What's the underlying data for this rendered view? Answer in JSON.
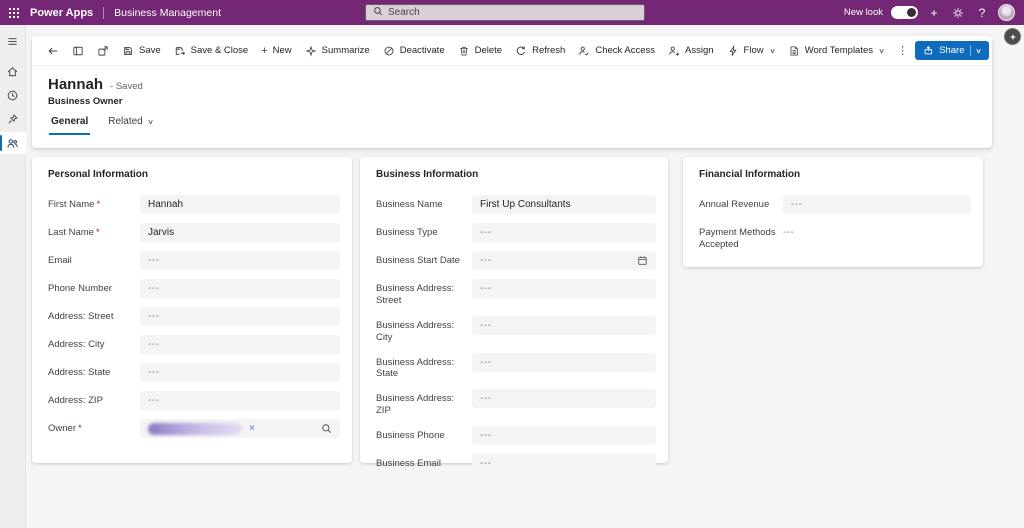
{
  "topbar": {
    "app": "Power Apps",
    "section": "Business Management",
    "search_placeholder": "Search",
    "new_look": "New look"
  },
  "commandbar": {
    "save": "Save",
    "save_close": "Save & Close",
    "new": "New",
    "summarize": "Summarize",
    "deactivate": "Deactivate",
    "delete": "Delete",
    "refresh": "Refresh",
    "check_access": "Check Access",
    "assign": "Assign",
    "flow": "Flow",
    "word_templates": "Word Templates",
    "share": "Share"
  },
  "record": {
    "title": "Hannah",
    "status": "- Saved",
    "entity": "Business Owner",
    "tabs": [
      {
        "label": "General"
      },
      {
        "label": "Related"
      }
    ]
  },
  "ui": {
    "required_marker": "*",
    "dismiss_glyph": "×"
  },
  "icons": {
    "plus": "+",
    "question": "?",
    "more": "⋮",
    "chevron": "∨"
  },
  "cards": [
    {
      "title": "Personal Information",
      "fields": [
        {
          "label": "First Name",
          "required": true,
          "value": "Hannah",
          "type": "text"
        },
        {
          "label": "Last Name",
          "required": true,
          "value": "Jarvis",
          "type": "text"
        },
        {
          "label": "Email",
          "value": "---",
          "empty": true,
          "type": "text"
        },
        {
          "label": "Phone Number",
          "value": "---",
          "empty": true,
          "type": "text"
        },
        {
          "label": "Address: Street",
          "value": "---",
          "empty": true,
          "type": "text"
        },
        {
          "label": "Address: City",
          "value": "---",
          "empty": true,
          "type": "text"
        },
        {
          "label": "Address: State",
          "value": "---",
          "empty": true,
          "type": "text"
        },
        {
          "label": "Address: ZIP",
          "value": "---",
          "empty": true,
          "type": "text"
        },
        {
          "label": "Owner",
          "required": true,
          "value": "",
          "type": "lookup"
        }
      ]
    },
    {
      "title": "Business Information",
      "fields": [
        {
          "label": "Business Name",
          "value": "First Up Consultants",
          "type": "text"
        },
        {
          "label": "Business Type",
          "value": "---",
          "empty": true,
          "type": "text"
        },
        {
          "label": "Business Start Date",
          "value": "---",
          "empty": true,
          "type": "date"
        },
        {
          "label": "Business Address: Street",
          "value": "---",
          "empty": true,
          "type": "text"
        },
        {
          "label": "Business Address: City",
          "value": "---",
          "empty": true,
          "type": "text"
        },
        {
          "label": "Business Address: State",
          "value": "---",
          "empty": true,
          "type": "text"
        },
        {
          "label": "Business Address: ZIP",
          "value": "---",
          "empty": true,
          "type": "text"
        },
        {
          "label": "Business Phone",
          "value": "---",
          "empty": true,
          "type": "text"
        },
        {
          "label": "Business Email",
          "value": "---",
          "empty": true,
          "type": "text"
        }
      ]
    },
    {
      "title": "Financial Information",
      "fields": [
        {
          "label": "Annual Revenue",
          "value": "---",
          "empty": true,
          "type": "text"
        },
        {
          "label": "Payment Methods Accepted",
          "value": "---",
          "empty": true,
          "type": "plain"
        }
      ]
    }
  ]
}
